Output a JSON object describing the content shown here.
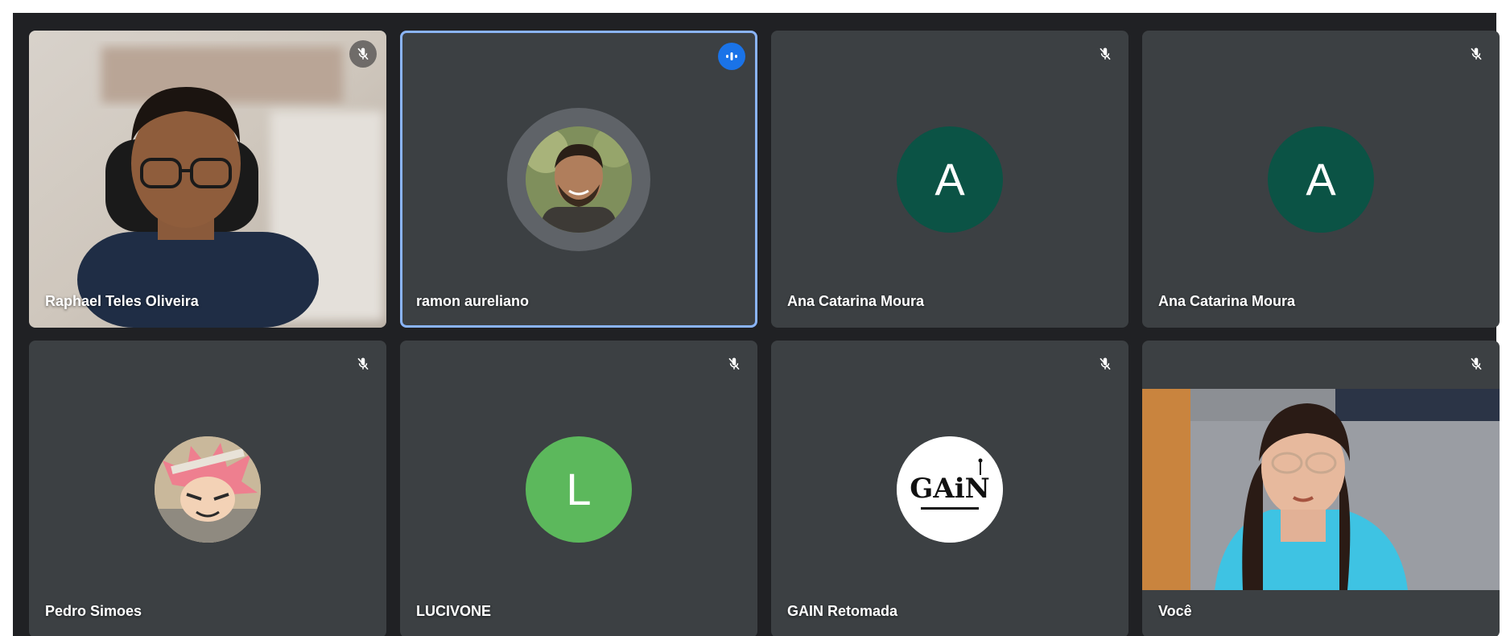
{
  "colors": {
    "meet_bg": "#202124",
    "tile_bg": "#3c4043",
    "speaking_border": "#8ab4f8",
    "speaking_badge": "#1a73e8",
    "avatar_green_dark": "#0b5345",
    "avatar_green_light": "#5cb85c"
  },
  "participants": [
    {
      "name": "Raphael Teles Oliveira",
      "status_icon": "mic-off-icon",
      "media": "camera-video"
    },
    {
      "name": "ramon aureliano",
      "status_icon": "speaking-indicator-icon",
      "media": "profile-photo"
    },
    {
      "name": "Ana Catarina Moura",
      "status_icon": "mic-off-icon",
      "media": "letter-avatar",
      "initial": "A"
    },
    {
      "name": "Ana Catarina Moura",
      "status_icon": "mic-off-icon",
      "media": "letter-avatar",
      "initial": "A"
    },
    {
      "name": "Pedro Simoes",
      "status_icon": "mic-off-icon",
      "media": "profile-photo"
    },
    {
      "name": "LUCIVONE",
      "status_icon": "mic-off-icon",
      "media": "letter-avatar",
      "initial": "L"
    },
    {
      "name": "GAIN Retomada",
      "status_icon": "mic-off-icon",
      "media": "logo-avatar",
      "logo_text": "GAiN"
    },
    {
      "name": "Você",
      "status_icon": "mic-off-icon",
      "media": "camera-video"
    }
  ]
}
